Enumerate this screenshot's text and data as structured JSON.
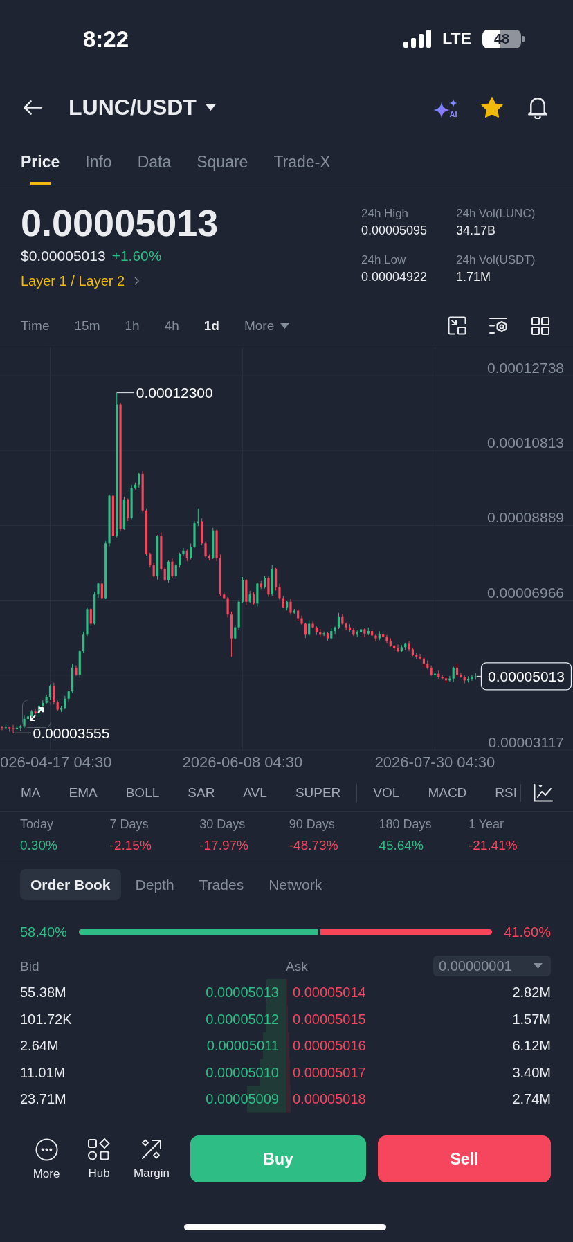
{
  "status_bar": {
    "time": "8:22",
    "network": "LTE",
    "battery": "48"
  },
  "header": {
    "pair": "LUNC/USDT",
    "ai_badge": "AI",
    "favorite": true
  },
  "tabs": [
    {
      "label": "Price",
      "selected": true
    },
    {
      "label": "Info",
      "selected": false
    },
    {
      "label": "Data",
      "selected": false
    },
    {
      "label": "Square",
      "selected": false
    },
    {
      "label": "Trade-X",
      "selected": false
    }
  ],
  "ticker": {
    "price": "0.00005013",
    "fiat_price": "$0.00005013",
    "change": "+1.60%",
    "up": true,
    "category": "Layer 1 / Layer 2",
    "stats": [
      {
        "label": "24h High",
        "value": "0.00005095"
      },
      {
        "label": "24h Vol(LUNC)",
        "value": "34.17B"
      },
      {
        "label": "24h Low",
        "value": "0.00004922"
      },
      {
        "label": "24h Vol(USDT)",
        "value": "1.71M"
      }
    ]
  },
  "intervals": [
    {
      "label": "Time",
      "selected": false,
      "kind": "option"
    },
    {
      "label": "15m",
      "selected": false,
      "kind": "option"
    },
    {
      "label": "1h",
      "selected": false,
      "kind": "option"
    },
    {
      "label": "4h",
      "selected": false,
      "kind": "option"
    },
    {
      "label": "1d",
      "selected": true,
      "kind": "option"
    },
    {
      "label": "More",
      "selected": false,
      "kind": "menu"
    }
  ],
  "chart": {
    "high_label": "0.00012300",
    "low_label": "0.00003555",
    "last_price": "0.00005013",
    "chart_data": {
      "type": "candlestick",
      "grid": true,
      "ylim": [
        3.117e-05,
        0.00012738
      ],
      "yticks": [
        {
          "value": 0.00012738,
          "label": "0.00012738"
        },
        {
          "value": 0.00010813,
          "label": "0.00010813"
        },
        {
          "value": 8.889e-05,
          "label": "0.00008889"
        },
        {
          "value": 6.966e-05,
          "label": "0.00006966"
        },
        {
          "value": 3.117e-05,
          "label": "0.00003117"
        }
      ],
      "categories": [
        null,
        null,
        null,
        null,
        null,
        null,
        null,
        null,
        null,
        null,
        null,
        null,
        null,
        "026-04-17 04:30",
        null,
        null,
        null,
        null,
        null,
        null,
        null,
        null,
        null,
        null,
        null,
        null,
        null,
        null,
        null,
        null,
        null,
        null,
        null,
        null,
        null,
        null,
        null,
        null,
        null,
        null,
        null,
        null,
        null,
        null,
        null,
        null,
        null,
        null,
        null,
        null,
        null,
        null,
        null,
        null,
        null,
        null,
        null,
        null,
        null,
        null,
        null,
        null,
        null,
        null,
        null,
        "2026-06-08 04:30",
        null,
        null,
        null,
        null,
        null,
        null,
        null,
        null,
        null,
        null,
        null,
        null,
        null,
        null,
        null,
        null,
        null,
        null,
        null,
        null,
        null,
        null,
        null,
        null,
        null,
        null,
        null,
        null,
        null,
        null,
        null,
        null,
        null,
        null,
        null,
        null,
        null,
        null,
        null,
        null,
        null,
        null,
        null,
        null,
        null,
        null,
        null,
        null,
        null,
        null,
        null,
        "2026-07-30 04:30",
        null,
        null,
        null,
        null,
        null,
        null,
        null,
        null,
        null,
        null,
        null
      ],
      "ohlc": [
        [
          3.7e-05,
          3.74e-05,
          3.626e-05,
          3.686e-05
        ],
        [
          3.686e-05,
          3.77e-05,
          3.656e-05,
          3.7e-05
        ],
        [
          3.7e-05,
          3.725e-05,
          3.591e-05,
          3.676e-05
        ],
        [
          3.676e-05,
          3.766e-05,
          3.555e-05,
          3.657e-05
        ],
        [
          3.657e-05,
          3.745e-05,
          3.632e-05,
          3.69e-05
        ],
        [
          3.69e-05,
          3.763e-05,
          3.615e-05,
          3.733e-05
        ],
        [
          3.733e-05,
          4e-05,
          3.683e-05,
          3.92e-05
        ],
        [
          3.92e-05,
          4.025e-05,
          3.885e-05,
          3.98e-05
        ],
        [
          3.98e-05,
          4.148e-05,
          3.92e-05,
          4.108e-05
        ],
        [
          4.108e-05,
          4.178e-05,
          4.03e-05,
          4.06e-05
        ],
        [
          4.06e-05,
          4.274e-05,
          3.975e-05,
          4.249e-05
        ],
        [
          4.249e-05,
          4.42e-05,
          4.209e-05,
          4.33e-05
        ],
        [
          4.33e-05,
          4.539e-05,
          4.305e-05,
          4.484e-05
        ],
        [
          4.484e-05,
          4.796e-05,
          4.409e-05,
          4.766e-05
        ],
        [
          4.766e-05,
          4.846e-05,
          4.293e-05,
          4.343e-05
        ],
        [
          4.343e-05,
          4.388e-05,
          4.12e-05,
          4.155e-05
        ],
        [
          4.155e-05,
          4.242e-05,
          4.095e-05,
          4.202e-05
        ],
        [
          4.202e-05,
          4.507e-05,
          4.172e-05,
          4.437e-05
        ],
        [
          4.437e-05,
          4.65e-05,
          4.352e-05,
          4.625e-05
        ],
        [
          4.625e-05,
          5.326e-05,
          4.585e-05,
          5.236e-05
        ],
        [
          5.236e-05,
          5.291e-05,
          5.023e-05,
          5.048e-05
        ],
        [
          5.048e-05,
          5.688e-05,
          4.973e-05,
          5.658e-05
        ],
        [
          5.658e-05,
          6.161e-05,
          5.608e-05,
          6.081e-05
        ],
        [
          6.081e-05,
          6.784e-05,
          6.046e-05,
          6.739e-05
        ],
        [
          6.739e-05,
          6.779e-05,
          6.303e-05,
          6.363e-05
        ],
        [
          6.363e-05,
          7.185e-05,
          6.333e-05,
          7.115e-05
        ],
        [
          7.115e-05,
          7.421e-05,
          7.03e-05,
          7.396e-05
        ],
        [
          7.396e-05,
          7.486e-05,
          6.981e-05,
          7.021e-05
        ],
        [
          7.021e-05,
          8.485e-05,
          6.996e-05,
          8.43e-05
        ],
        [
          8.43e-05,
          9.681e-05,
          8.355e-05,
          9.651e-05
        ],
        [
          9.651e-05,
          9.731e-05,
          8.568e-05,
          8.618e-05
        ],
        [
          8.618e-05,
          0.000123,
          8.583e-05,
          0.00012
        ],
        [
          0.00012,
          0.0001204,
          8.746e-05,
          8.806e-05
        ],
        [
          8.806e-05,
          9.627e-05,
          8.776e-05,
          9.557e-05
        ],
        [
          9.557e-05,
          9.582e-05,
          9.003e-05,
          9.088e-05
        ],
        [
          9.088e-05,
          9.929e-05,
          9.048e-05,
          9.839e-05
        ],
        [
          9.839e-05,
          9.988e-05,
          9.814e-05,
          9.933e-05
        ],
        [
          9.933e-05,
          0.00010245,
          9.858e-05,
          0.00010215
        ],
        [
          0.00010215,
          0.00010295,
          9.225e-05,
          9.275e-05
        ],
        [
          9.275e-05,
          9.32e-05,
          8.113e-05,
          8.148e-05
        ],
        [
          8.148e-05,
          8.188e-05,
          7.806e-05,
          7.866e-05
        ],
        [
          7.866e-05,
          7.936e-05,
          7.555e-05,
          7.585e-05
        ],
        [
          7.585e-05,
          8.643e-05,
          7.5e-05,
          8.618e-05
        ],
        [
          8.618e-05,
          8.708e-05,
          7.732e-05,
          7.772e-05
        ],
        [
          7.772e-05,
          7.827e-05,
          7.466e-05,
          7.491e-05
        ],
        [
          7.491e-05,
          7.99e-05,
          7.416e-05,
          7.96e-05
        ],
        [
          7.96e-05,
          8.04e-05,
          7.535e-05,
          7.585e-05
        ],
        [
          7.585e-05,
          7.911e-05,
          7.55e-05,
          7.866e-05
        ],
        [
          7.866e-05,
          8.188e-05,
          7.806e-05,
          8.148e-05
        ],
        [
          8.148e-05,
          8.312e-05,
          8.118e-05,
          8.242e-05
        ],
        [
          8.242e-05,
          8.267e-05,
          7.969e-05,
          8.054e-05
        ],
        [
          8.054e-05,
          8.426e-05,
          8.014e-05,
          8.336e-05
        ],
        [
          8.336e-05,
          9.002e-05,
          8.311e-05,
          8.947e-05
        ],
        [
          8.947e-05,
          9.322e-05,
          8.872e-05,
          8.994e-05
        ],
        [
          8.994e-05,
          9.074e-05,
          8.38e-05,
          8.43e-05
        ],
        [
          8.43e-05,
          8.475e-05,
          8.066e-05,
          8.101e-05
        ],
        [
          8.101e-05,
          8.141e-05,
          7.994e-05,
          8.054e-05
        ],
        [
          8.054e-05,
          8.829e-05,
          8.024e-05,
          8.759e-05
        ],
        [
          8.759e-05,
          8.784e-05,
          7.969e-05,
          8.054e-05
        ],
        [
          8.054e-05,
          8.144e-05,
          7.075e-05,
          7.115e-05
        ],
        [
          7.115e-05,
          7.17e-05,
          6.996e-05,
          7.021e-05
        ],
        [
          7.021e-05,
          7.051e-05,
          6.523e-05,
          6.598e-05
        ],
        [
          6.598e-05,
          6.678e-05,
          5.518e-05,
          5.987e-05
        ],
        [
          5.987e-05,
          6.314e-05,
          5.952e-05,
          6.269e-05
        ],
        [
          6.269e-05,
          6.967e-05,
          6.209e-05,
          6.927e-05
        ],
        [
          6.927e-05,
          7.561e-05,
          6.897e-05,
          7.491e-05
        ],
        [
          7.491e-05,
          7.516e-05,
          6.842e-05,
          6.927e-05
        ],
        [
          6.927e-05,
          7.205e-05,
          6.887e-05,
          7.115e-05
        ],
        [
          7.115e-05,
          7.17e-05,
          6.855e-05,
          6.88e-05
        ],
        [
          6.88e-05,
          7.426e-05,
          6.805e-05,
          7.396e-05
        ],
        [
          7.396e-05,
          7.476e-05,
          7.253e-05,
          7.303e-05
        ],
        [
          7.303e-05,
          7.583e-05,
          7.268e-05,
          7.538e-05
        ],
        [
          7.538e-05,
          7.578e-05,
          7.055e-05,
          7.115e-05
        ],
        [
          7.115e-05,
          7.866e-05,
          7.085e-05,
          7.772e-05
        ],
        [
          7.772e-05,
          7.797e-05,
          7.218e-05,
          7.303e-05
        ],
        [
          7.303e-05,
          7.393e-05,
          6.981e-05,
          7.021e-05
        ],
        [
          7.021e-05,
          7.076e-05,
          6.761e-05,
          6.786e-05
        ],
        [
          6.786e-05,
          6.957e-05,
          6.711e-05,
          6.927e-05
        ],
        [
          6.927e-05,
          7.007e-05,
          6.595e-05,
          6.645e-05
        ],
        [
          6.645e-05,
          6.745e-05,
          6.61e-05,
          6.7e-05
        ],
        [
          6.7e-05,
          6.74e-05,
          6.444e-05,
          6.504e-05
        ],
        [
          6.504e-05,
          6.574e-05,
          6.333e-05,
          6.363e-05
        ],
        [
          6.363e-05,
          6.388e-05,
          5.996e-05,
          6.081e-05
        ],
        [
          6.081e-05,
          6.453e-05,
          6.041e-05,
          6.363e-05
        ],
        [
          6.363e-05,
          6.418e-05,
          6.244e-05,
          6.269e-05
        ],
        [
          6.269e-05,
          6.299e-05,
          6.075e-05,
          6.15e-05
        ],
        [
          6.15e-05,
          6.23e-05,
          6.031e-05,
          6.081e-05
        ],
        [
          6.081e-05,
          6.165e-05,
          6.046e-05,
          6.12e-05
        ],
        [
          6.12e-05,
          6.16e-05,
          5.927e-05,
          5.987e-05
        ],
        [
          5.987e-05,
          6.245e-05,
          5.957e-05,
          6.175e-05
        ],
        [
          6.175e-05,
          6.294e-05,
          6.09e-05,
          6.269e-05
        ],
        [
          6.269e-05,
          6.641e-05,
          6.229e-05,
          6.551e-05
        ],
        [
          6.551e-05,
          6.606e-05,
          6.338e-05,
          6.363e-05
        ],
        [
          6.363e-05,
          6.393e-05,
          6.194e-05,
          6.269e-05
        ],
        [
          6.269e-05,
          6.349e-05,
          6.15e-05,
          6.2e-05
        ],
        [
          6.2e-05,
          6.245e-05,
          6.046e-05,
          6.081e-05
        ],
        [
          6.081e-05,
          6.19e-05,
          6.021e-05,
          6.15e-05
        ],
        [
          6.15e-05,
          6.292e-05,
          6.12e-05,
          6.222e-05
        ],
        [
          6.222e-05,
          6.247e-05,
          6.025e-05,
          6.11e-05
        ],
        [
          6.11e-05,
          6.265e-05,
          6.07e-05,
          6.175e-05
        ],
        [
          6.175e-05,
          6.23e-05,
          6.035e-05,
          6.06e-05
        ],
        [
          6.06e-05,
          6.09e-05,
          5.912e-05,
          5.987e-05
        ],
        [
          5.987e-05,
          6.17e-05,
          5.937e-05,
          6.09e-05
        ],
        [
          6.09e-05,
          6.135e-05,
          5.999e-05,
          6.034e-05
        ],
        [
          6.034e-05,
          6.074e-05,
          5.86e-05,
          5.92e-05
        ],
        [
          5.92e-05,
          5.99e-05,
          5.77e-05,
          5.8e-05
        ],
        [
          5.8e-05,
          5.825e-05,
          5.655e-05,
          5.74e-05
        ],
        [
          5.74e-05,
          5.83e-05,
          5.618e-05,
          5.658e-05
        ],
        [
          5.658e-05,
          5.815e-05,
          5.633e-05,
          5.76e-05
        ],
        [
          5.76e-05,
          5.877e-05,
          5.685e-05,
          5.847e-05
        ],
        [
          5.847e-05,
          5.927e-05,
          5.656e-05,
          5.706e-05
        ],
        [
          5.706e-05,
          5.751e-05,
          5.53e-05,
          5.565e-05
        ],
        [
          5.565e-05,
          5.605e-05,
          5.46e-05,
          5.52e-05
        ],
        [
          5.52e-05,
          5.59e-05,
          5.441e-05,
          5.471e-05
        ],
        [
          5.471e-05,
          5.496e-05,
          5.245e-05,
          5.33e-05
        ],
        [
          5.33e-05,
          5.42e-05,
          5.196e-05,
          5.236e-05
        ],
        [
          5.236e-05,
          5.291e-05,
          5.023e-05,
          5.048e-05
        ],
        [
          5.048e-05,
          5.11e-05,
          4.973e-05,
          5.08e-05
        ],
        [
          5.08e-05,
          5.16e-05,
          4.951e-05,
          5.001e-05
        ],
        [
          5.001e-05,
          5.046e-05,
          4.925e-05,
          4.96e-05
        ],
        [
          4.96e-05,
          5e-05,
          4.847e-05,
          4.907e-05
        ],
        [
          4.907e-05,
          5.024e-05,
          4.877e-05,
          4.954e-05
        ],
        [
          4.954e-05,
          5.261e-05,
          4.869e-05,
          5.236e-05
        ],
        [
          5.236e-05,
          5.326e-05,
          5.008e-05,
          5.048e-05
        ],
        [
          5.048e-05,
          5.103e-05,
          4.976e-05,
          5.001e-05
        ],
        [
          5.001e-05,
          5.031e-05,
          4.832e-05,
          4.907e-05
        ],
        [
          4.907e-05,
          5.015e-05,
          4.857e-05,
          4.935e-05
        ],
        [
          4.935e-05,
          5.046e-05,
          4.9e-05,
          5.001e-05
        ],
        [
          5.001e-05,
          5.095e-05,
          4.922e-05,
          5.013e-05
        ]
      ]
    }
  },
  "indicators": {
    "overlays": [
      "MA",
      "EMA",
      "BOLL",
      "SAR",
      "AVL",
      "SUPER"
    ],
    "oscillators": [
      "VOL",
      "MACD",
      "RSI"
    ]
  },
  "performance": [
    {
      "label": "Today",
      "value": "0.30%",
      "up": true
    },
    {
      "label": "7 Days",
      "value": "-2.15%",
      "up": false
    },
    {
      "label": "30 Days",
      "value": "-17.97%",
      "up": false
    },
    {
      "label": "90 Days",
      "value": "-48.73%",
      "up": false
    },
    {
      "label": "180 Days",
      "value": "45.64%",
      "up": true
    },
    {
      "label": "1 Year",
      "value": "-21.41%",
      "up": false
    }
  ],
  "order_book": {
    "tabs": [
      {
        "label": "Order Book",
        "selected": true
      },
      {
        "label": "Depth",
        "selected": false
      },
      {
        "label": "Trades",
        "selected": false
      },
      {
        "label": "Network",
        "selected": false
      }
    ],
    "ratio": {
      "buy": "58.40%",
      "sell": "41.60%",
      "level": 0.584
    },
    "bid_header": "Bid",
    "ask_header": "Ask",
    "precision": "0.00000001",
    "rows": [
      {
        "bid": {
          "amount": "55.38M",
          "price": "0.00005013"
        },
        "ask": {
          "price": "0.00005014",
          "amount": "2.82M"
        }
      },
      {
        "bid": {
          "amount": "101.72K",
          "price": "0.00005012"
        },
        "ask": {
          "price": "0.00005015",
          "amount": "1.57M"
        }
      },
      {
        "bid": {
          "amount": "2.64M",
          "price": "0.00005011"
        },
        "ask": {
          "price": "0.00005016",
          "amount": "6.12M"
        }
      },
      {
        "bid": {
          "amount": "11.01M",
          "price": "0.00005010"
        },
        "ask": {
          "price": "0.00005017",
          "amount": "3.40M"
        }
      },
      {
        "bid": {
          "amount": "23.71M",
          "price": "0.00005009"
        },
        "ask": {
          "price": "0.00005018",
          "amount": "2.74M"
        }
      }
    ]
  },
  "actions": {
    "shortcuts": [
      "More",
      "Hub",
      "Margin"
    ],
    "buy": "Buy",
    "sell": "Sell"
  }
}
